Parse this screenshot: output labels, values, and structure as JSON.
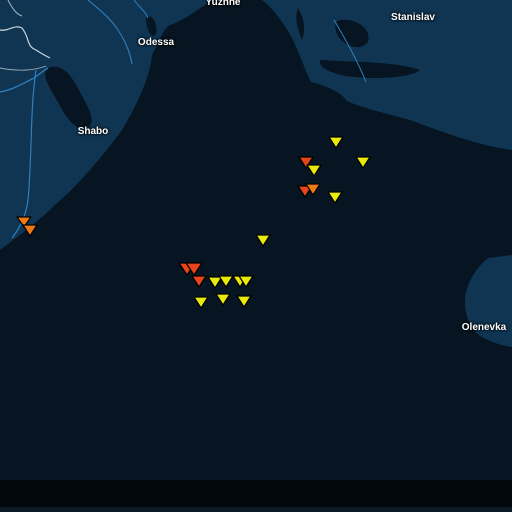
{
  "map": {
    "colors": {
      "water": "#061521",
      "land": "#0f3552",
      "river": "#2e7fbf",
      "border": "#c8d4dc",
      "label": "#ffffff",
      "marker_red": "#e8461a",
      "marker_orange": "#f07a12",
      "marker_yellow": "#e8ea0c"
    },
    "labels": {
      "yuzhne": "Yuzhne",
      "odessa": "Odessa",
      "stanislav": "Stanislav",
      "shabo": "Shabo",
      "olenevka": "Olenevka"
    },
    "marker_icon": "inverted-triangle-icon",
    "markers": [
      {
        "color": "orange"
      },
      {
        "color": "orange"
      },
      {
        "color": "red"
      },
      {
        "color": "yellow"
      },
      {
        "color": "red"
      },
      {
        "color": "orange"
      },
      {
        "color": "yellow"
      },
      {
        "color": "yellow"
      },
      {
        "color": "yellow"
      },
      {
        "color": "yellow"
      },
      {
        "color": "red"
      },
      {
        "color": "red"
      },
      {
        "color": "red"
      },
      {
        "color": "yellow"
      },
      {
        "color": "yellow"
      },
      {
        "color": "yellow"
      },
      {
        "color": "yellow"
      },
      {
        "color": "yellow"
      },
      {
        "color": "yellow"
      },
      {
        "color": "yellow"
      }
    ]
  }
}
